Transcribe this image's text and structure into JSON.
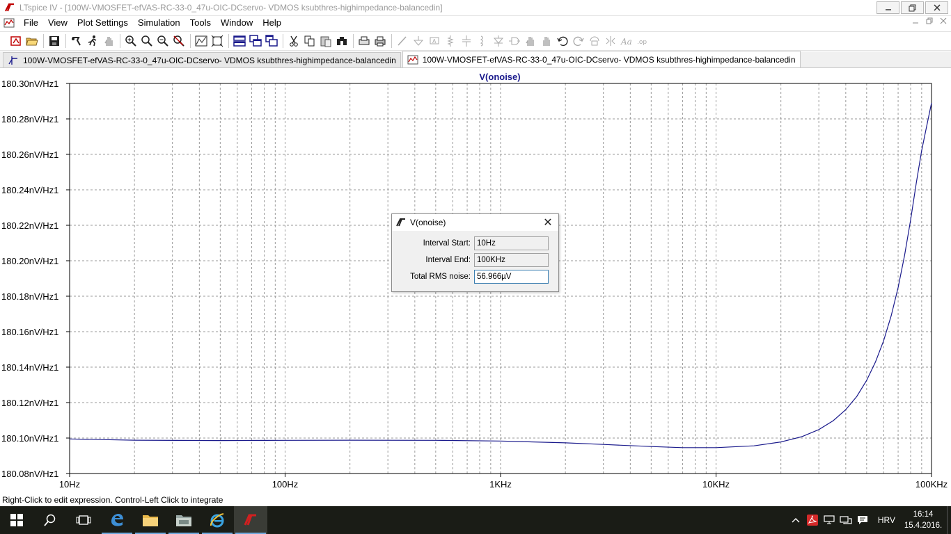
{
  "window": {
    "title": "LTspice IV - [100W-VMOSFET-efVAS-RC-33-0_47u-OIC-DCservo- VDMOS ksubthres-highimpedance-balancedin]",
    "controls": [
      "minimize",
      "restore",
      "close"
    ]
  },
  "menu": {
    "items": [
      "File",
      "View",
      "Plot Settings",
      "Simulation",
      "Tools",
      "Window",
      "Help"
    ]
  },
  "toolbar": {
    "icons": [
      "open-schematic-icon",
      "open-file-icon",
      "save-icon",
      "control-panel-icon",
      "run-icon",
      "halt-icon",
      "zoom-in-icon",
      "zoom-area-icon",
      "zoom-out-icon",
      "zoom-cancel-icon",
      "autorange-icon",
      "zoom-fit-icon",
      "tile-horizontal-icon",
      "cascade-icon",
      "tile-vertical-icon",
      "cut-icon",
      "copy-icon",
      "paste-icon",
      "find-icon",
      "print-setup-icon",
      "print-icon",
      "wire-icon",
      "ground-icon",
      "label-icon",
      "resistor-icon",
      "capacitor-icon",
      "inductor-icon",
      "diode-icon",
      "component-icon",
      "move-icon",
      "drag-icon",
      "undo-icon",
      "redo-icon",
      "rotate-icon",
      "mirror-icon",
      "text-icon",
      "spice-directive-icon"
    ]
  },
  "tabs": [
    {
      "label": "100W-VMOSFET-efVAS-RC-33-0_47u-OIC-DCservo- VDMOS ksubthres-highimpedance-balancedin",
      "kind": "schematic",
      "active": false
    },
    {
      "label": "100W-VMOSFET-efVAS-RC-33-0_47u-OIC-DCservo- VDMOS ksubthres-highimpedance-balancedin",
      "kind": "waveform",
      "active": true
    }
  ],
  "colors": {
    "trace": "#1a1a8c",
    "grid": "#9a9a9a",
    "frame": "#000000",
    "title": "#1a1a8c"
  },
  "chart_data": {
    "type": "line",
    "title": "V(onoise)",
    "xscale": "log",
    "xlim": [
      10,
      100000
    ],
    "ylim": [
      180.08,
      180.3
    ],
    "xticks": [
      {
        "v": 10,
        "label": "10Hz"
      },
      {
        "v": 100,
        "label": "100Hz"
      },
      {
        "v": 1000,
        "label": "1KHz"
      },
      {
        "v": 10000,
        "label": "10KHz"
      },
      {
        "v": 100000,
        "label": "100KHz"
      }
    ],
    "yticks": [
      {
        "v": 180.3,
        "label": "180.30nV/Hz1"
      },
      {
        "v": 180.28,
        "label": "180.28nV/Hz1"
      },
      {
        "v": 180.26,
        "label": "180.26nV/Hz1"
      },
      {
        "v": 180.24,
        "label": "180.24nV/Hz1"
      },
      {
        "v": 180.22,
        "label": "180.22nV/Hz1"
      },
      {
        "v": 180.2,
        "label": "180.20nV/Hz1"
      },
      {
        "v": 180.18,
        "label": "180.18nV/Hz1"
      },
      {
        "v": 180.16,
        "label": "180.16nV/Hz1"
      },
      {
        "v": 180.14,
        "label": "180.14nV/Hz1"
      },
      {
        "v": 180.12,
        "label": "180.12nV/Hz1"
      },
      {
        "v": 180.1,
        "label": "180.10nV/Hz1"
      },
      {
        "v": 180.08,
        "label": "180.08nV/Hz1"
      }
    ],
    "grid": true,
    "series": [
      {
        "name": "V(onoise)",
        "x": [
          10,
          20,
          50,
          100,
          200,
          500,
          1000,
          2000,
          3000,
          5000,
          7000,
          10000,
          15000,
          20000,
          25000,
          30000,
          35000,
          40000,
          45000,
          50000,
          55000,
          60000,
          65000,
          70000,
          75000,
          80000,
          85000,
          90000,
          95000,
          100000
        ],
        "y": [
          180.0995,
          180.0988,
          180.0986,
          180.0987,
          180.0988,
          180.0987,
          180.0983,
          180.0973,
          180.0964,
          180.0952,
          180.0946,
          180.0946,
          180.0956,
          180.0978,
          180.1008,
          180.1048,
          180.1098,
          180.116,
          180.1235,
          180.1325,
          180.143,
          180.155,
          180.169,
          180.185,
          180.203,
          180.223,
          180.244,
          180.262,
          180.276,
          180.289
        ]
      }
    ]
  },
  "dialog": {
    "title": "V(onoise)",
    "close_glyph": "✕",
    "rows": [
      {
        "label": "Interval Start:",
        "value": "10Hz"
      },
      {
        "label": "Interval End:",
        "value": "100KHz"
      },
      {
        "label": "Total RMS noise:",
        "value": "56.966µV"
      }
    ]
  },
  "status": {
    "text": "Right-Click to edit expression. Control-Left Click to integrate"
  },
  "taskbar": {
    "apps": [
      "start-icon",
      "search-icon",
      "task-view-icon",
      "edge-icon",
      "file-explorer-icon",
      "store-folder-icon",
      "internet-explorer-icon",
      "ltspice-icon"
    ],
    "language": "HRV",
    "time": "16:14",
    "date": "15.4.2016."
  }
}
